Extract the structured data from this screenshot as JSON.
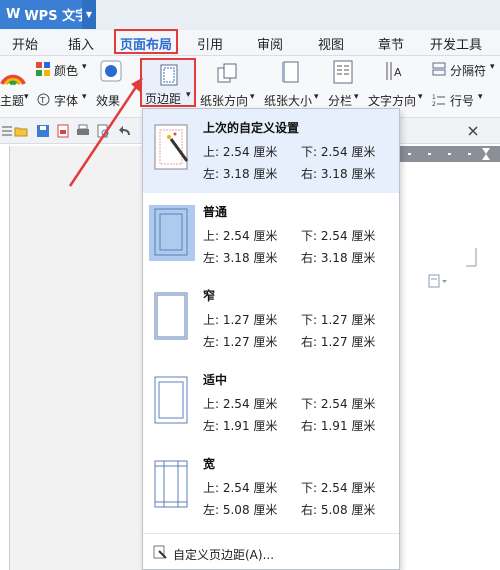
{
  "app": {
    "logo": "W",
    "title": "WPS 文字",
    "caret": "▼"
  },
  "tabs": [
    "开始",
    "插入",
    "页面布局",
    "引用",
    "审阅",
    "视图",
    "章节",
    "开发工具"
  ],
  "ribbon": {
    "color_label": "颜色",
    "theme_label": "主题",
    "font_label": "字体",
    "effect_label": "效果",
    "margins_label": "页边距",
    "orientation_label": "纸张方向",
    "size_label": "纸张大小",
    "columns_label": "分栏",
    "text_direction_label": "文字方向",
    "separator_label": "分隔符",
    "line_number_label": "行号"
  },
  "dropdown": {
    "options": [
      {
        "title": "上次的自定义设置",
        "top": "上: 2.54 厘米",
        "bottom": "下: 2.54 厘米",
        "left": "左: 3.18 厘米",
        "right": "右: 3.18 厘米"
      },
      {
        "title": "普通",
        "top": "上: 2.54 厘米",
        "bottom": "下: 2.54 厘米",
        "left": "左: 3.18 厘米",
        "right": "右: 3.18 厘米"
      },
      {
        "title": "窄",
        "top": "上: 1.27 厘米",
        "bottom": "下: 1.27 厘米",
        "left": "左: 1.27 厘米",
        "right": "右: 1.27 厘米"
      },
      {
        "title": "适中",
        "top": "上: 2.54 厘米",
        "bottom": "下: 2.54 厘米",
        "left": "左: 1.91 厘米",
        "right": "右: 1.91 厘米"
      },
      {
        "title": "宽",
        "top": "上: 2.54 厘米",
        "bottom": "下: 2.54 厘米",
        "left": "左: 5.08 厘米",
        "right": "右: 5.08 厘米"
      }
    ],
    "footer_label": "自定义页边距(A)..."
  },
  "colors": {
    "accent": "#2b6cd1",
    "highlight_border": "#e23b3b",
    "selected_bg": "#e6effb"
  }
}
